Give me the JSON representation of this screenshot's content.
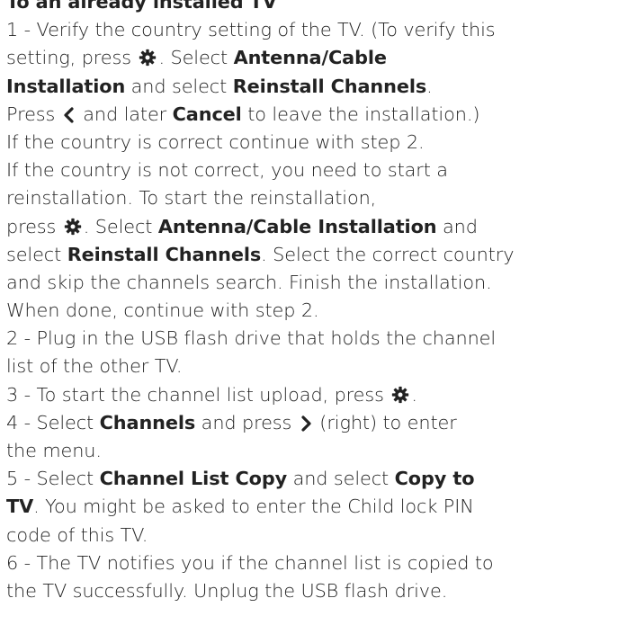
{
  "doc": {
    "lines": [
      [
        {
          "t": "To an already installed TV",
          "b": true
        }
      ],
      [
        {
          "t": "1 -  Verify the country setting of the TV. (To verify this"
        }
      ],
      [
        {
          "t": "setting, press  "
        },
        {
          "i": "gear-icon"
        },
        {
          "t": ". Select   "
        },
        {
          "t": "Antenna/Cable",
          "b": true
        }
      ],
      [
        {
          "t": "Installation",
          "b": true
        },
        {
          "t": " and select   "
        },
        {
          "t": "Reinstall Channels",
          "b": true
        },
        {
          "t": "."
        }
      ],
      [
        {
          "t": "Press  "
        },
        {
          "i": "chevron-left-icon"
        },
        {
          "t": " and later   "
        },
        {
          "t": "Cancel",
          "b": true
        },
        {
          "t": " to leave the installation.)"
        }
      ],
      [
        {
          "t": "If the country is correct continue with step 2."
        }
      ],
      [
        {
          "t": "If the country is not correct, you need to start a"
        }
      ],
      [
        {
          "t": "reinstallation. To start the reinstallation,"
        }
      ],
      [
        {
          "t": "press  "
        },
        {
          "i": "gear-icon"
        },
        {
          "t": ". Select   "
        },
        {
          "t": "Antenna/Cable Installation",
          "b": true
        },
        {
          "t": " and"
        }
      ],
      [
        {
          "t": "select  "
        },
        {
          "t": "Reinstall Channels",
          "b": true
        },
        {
          "t": ". Select the correct country"
        }
      ],
      [
        {
          "t": "and skip the channels search. Finish the installation."
        }
      ],
      [
        {
          "t": "When done, continue with step 2."
        }
      ],
      [
        {
          "t": "2 -  Plug in the USB flash drive that holds the channel"
        }
      ],
      [
        {
          "t": "list of the other TV."
        }
      ],
      [
        {
          "t": "3 -  To start the channel list upload, press   "
        },
        {
          "i": "gear-icon"
        },
        {
          "t": "."
        }
      ],
      [
        {
          "t": "4 -  Select  "
        },
        {
          "t": "Channels",
          "b": true
        },
        {
          "t": " and press   "
        },
        {
          "i": "chevron-right-icon"
        },
        {
          "t": " (right) to enter"
        }
      ],
      [
        {
          "t": "the menu."
        }
      ],
      [
        {
          "t": "5 -  Select  "
        },
        {
          "t": "Channel List Copy",
          "b": true
        },
        {
          "t": " and select   "
        },
        {
          "t": "Copy to",
          "b": true
        }
      ],
      [
        {
          "t": "TV",
          "b": true
        },
        {
          "t": ". You might be asked to enter the Child lock PIN"
        }
      ],
      [
        {
          "t": "code of this TV."
        }
      ],
      [
        {
          "t": "6 -  The TV notifies you if the channel list is copied to"
        }
      ],
      [
        {
          "t": "the TV successfully. Unplug the USB flash drive."
        }
      ]
    ]
  },
  "colors": {
    "text": "#222222",
    "background": "#ffffff"
  }
}
